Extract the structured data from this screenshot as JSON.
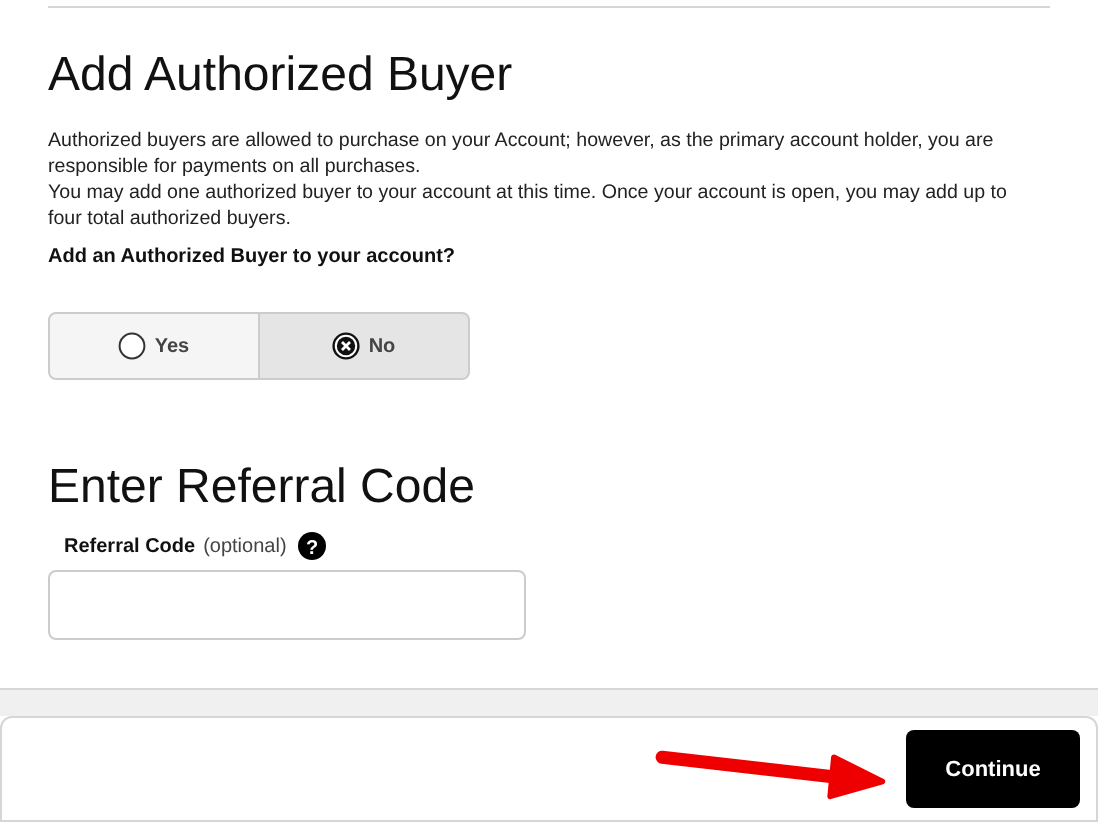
{
  "authorized_buyer": {
    "title": "Add Authorized Buyer",
    "paragraphs": [
      "Authorized buyers are allowed to purchase on your Account; however, as the primary account holder, you are responsible for payments on all purchases.",
      "You may add one authorized buyer to your account at this time. Once your account is open, you may add up to four total authorized buyers."
    ],
    "question": "Add an Authorized Buyer to your account?",
    "options": [
      {
        "label": "Yes",
        "selected": false
      },
      {
        "label": "No",
        "selected": true
      }
    ]
  },
  "referral": {
    "title": "Enter Referral Code",
    "label": "Referral Code",
    "hint": "(optional)",
    "help_icon": "?"
  },
  "footer": {
    "button": "Continue"
  }
}
